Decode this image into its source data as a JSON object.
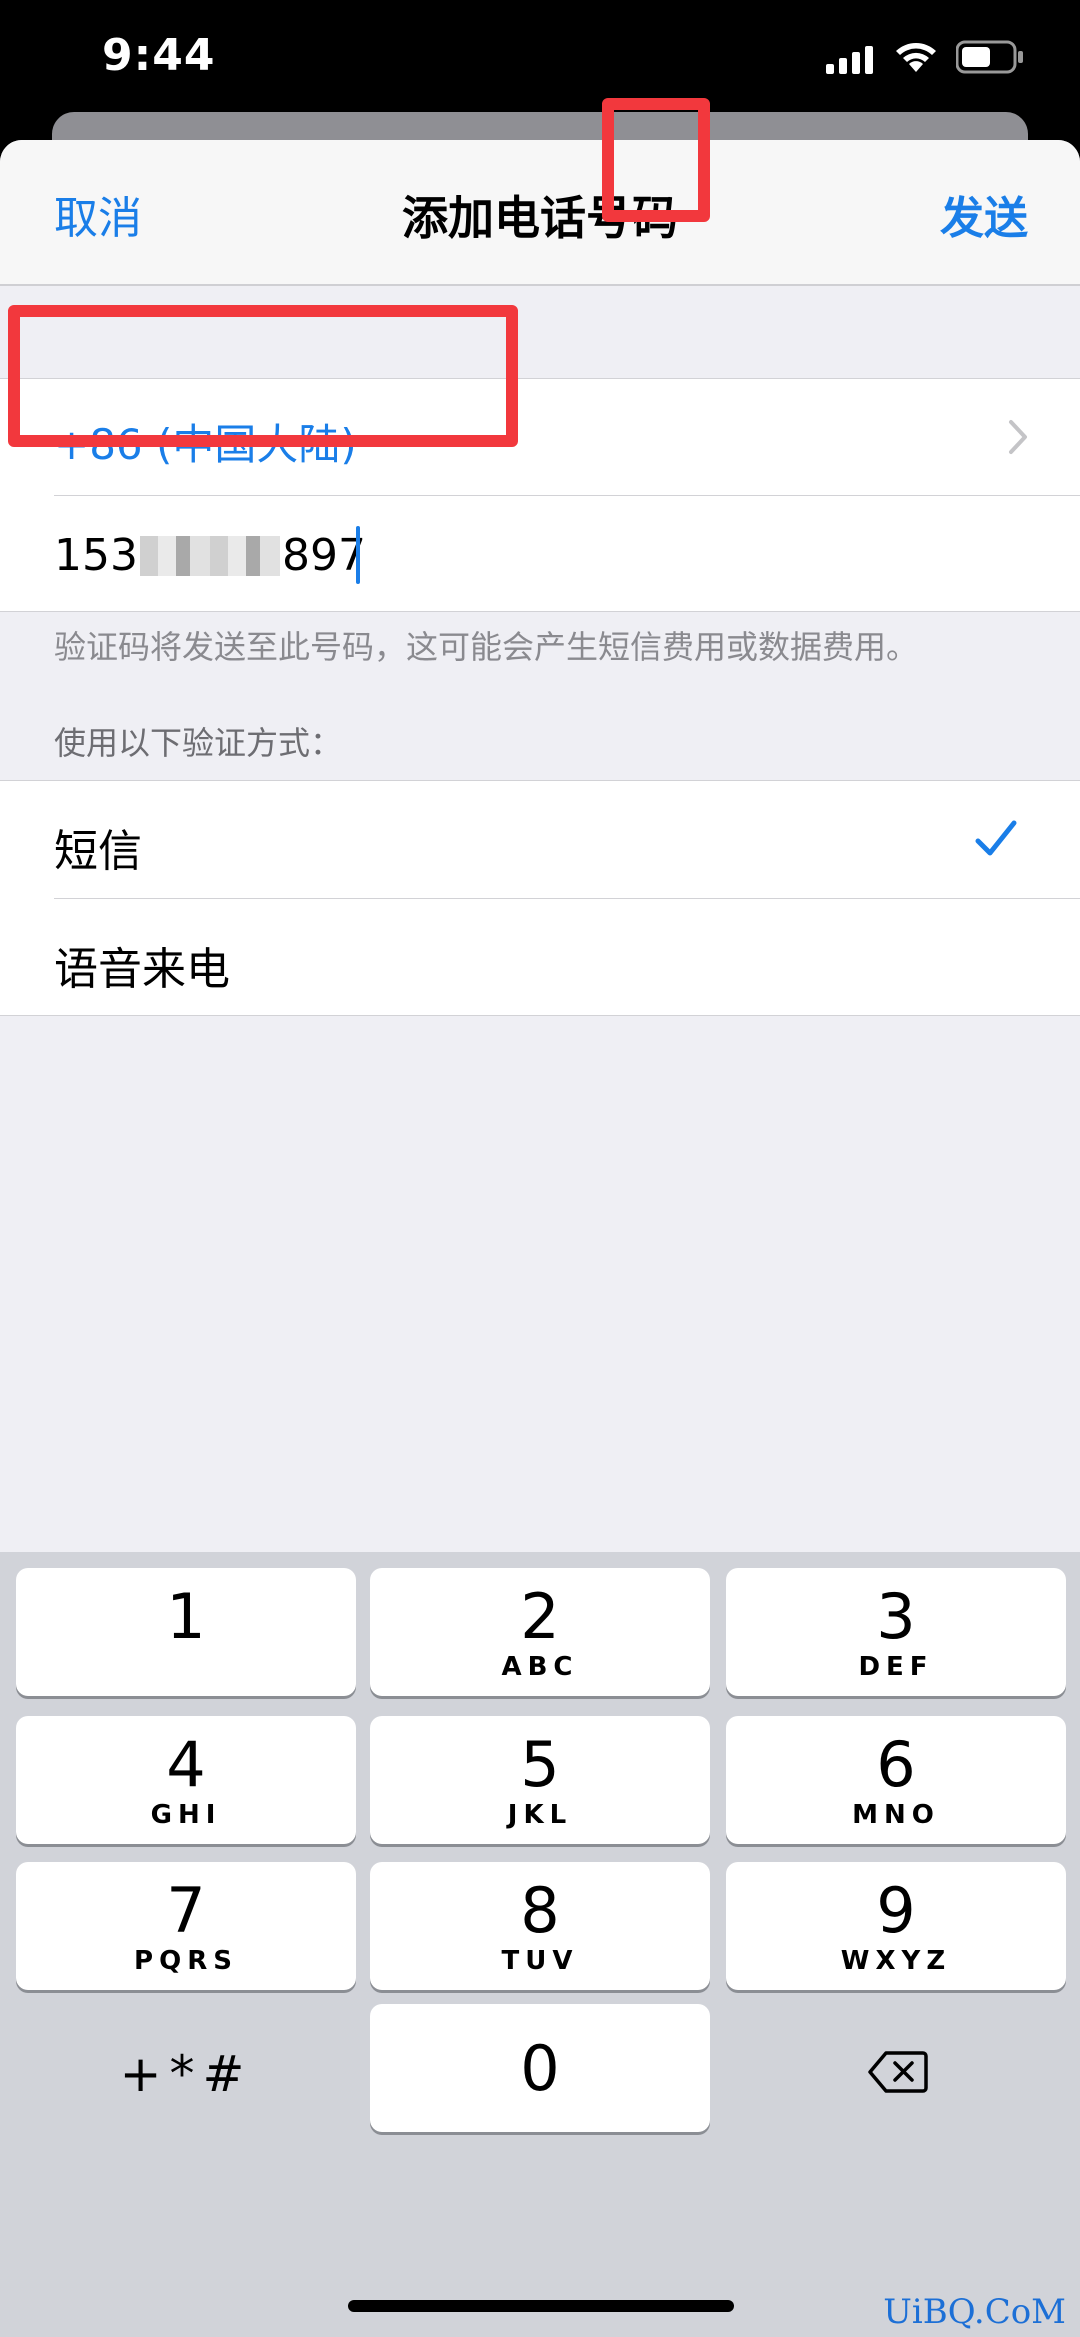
{
  "status_bar": {
    "time": "9:44"
  },
  "nav": {
    "cancel": "取消",
    "title": "添加电话号码",
    "send": "发送"
  },
  "phone": {
    "country": "+86 (中国大陆)",
    "prefix": "153",
    "suffix": "897"
  },
  "hint": "验证码将发送至此号码，这可能会产生短信费用或数据费用。",
  "verify_section": {
    "header": "使用以下验证方式：",
    "options": [
      "短信",
      "语音来电"
    ]
  },
  "keyboard": {
    "keys": [
      {
        "digit": "1",
        "letters": ""
      },
      {
        "digit": "2",
        "letters": "ABC"
      },
      {
        "digit": "3",
        "letters": "DEF"
      },
      {
        "digit": "4",
        "letters": "GHI"
      },
      {
        "digit": "5",
        "letters": "JKL"
      },
      {
        "digit": "6",
        "letters": "MNO"
      },
      {
        "digit": "7",
        "letters": "PQRS"
      },
      {
        "digit": "8",
        "letters": "TUV"
      },
      {
        "digit": "9",
        "letters": "WXYZ"
      },
      {
        "digit": "0",
        "letters": ""
      }
    ],
    "symbols": "+*#"
  },
  "watermark": "UiBQ.CoM",
  "colors": {
    "accent": "#1a7ee8",
    "highlight": "#f2383d"
  }
}
